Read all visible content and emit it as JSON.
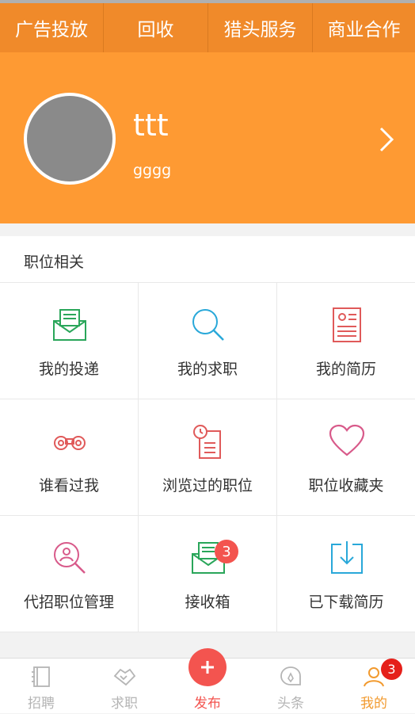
{
  "top_tabs": [
    "广告投放",
    "回收",
    "猎头服务",
    "商业合作"
  ],
  "profile": {
    "name": "ttt",
    "subtitle": "gggg"
  },
  "section_title": "职位相关",
  "grid_items": [
    {
      "label": "我的投递",
      "icon": "envelope-letter-icon"
    },
    {
      "label": "我的求职",
      "icon": "search-icon"
    },
    {
      "label": "我的简历",
      "icon": "resume-icon"
    },
    {
      "label": "谁看过我",
      "icon": "binoculars-icon"
    },
    {
      "label": "浏览过的职位",
      "icon": "history-doc-icon"
    },
    {
      "label": "职位收藏夹",
      "icon": "heart-icon"
    },
    {
      "label": "代招职位管理",
      "icon": "user-search-icon"
    },
    {
      "label": "接收箱",
      "icon": "inbox-envelope-icon",
      "badge": "3"
    },
    {
      "label": "已下载简历",
      "icon": "download-icon"
    }
  ],
  "nav": [
    {
      "label": "招聘",
      "icon": "notebook-icon"
    },
    {
      "label": "求职",
      "icon": "handshake-icon"
    },
    {
      "label": "发布",
      "icon": "plus-icon"
    },
    {
      "label": "头条",
      "icon": "headline-icon"
    },
    {
      "label": "我的",
      "icon": "user-icon",
      "badge": "3"
    }
  ],
  "colors": {
    "topbar": "#f08a2a",
    "profile_bg": "#fe9a33",
    "accent_red": "#f3544f",
    "active": "#f29a2e"
  }
}
